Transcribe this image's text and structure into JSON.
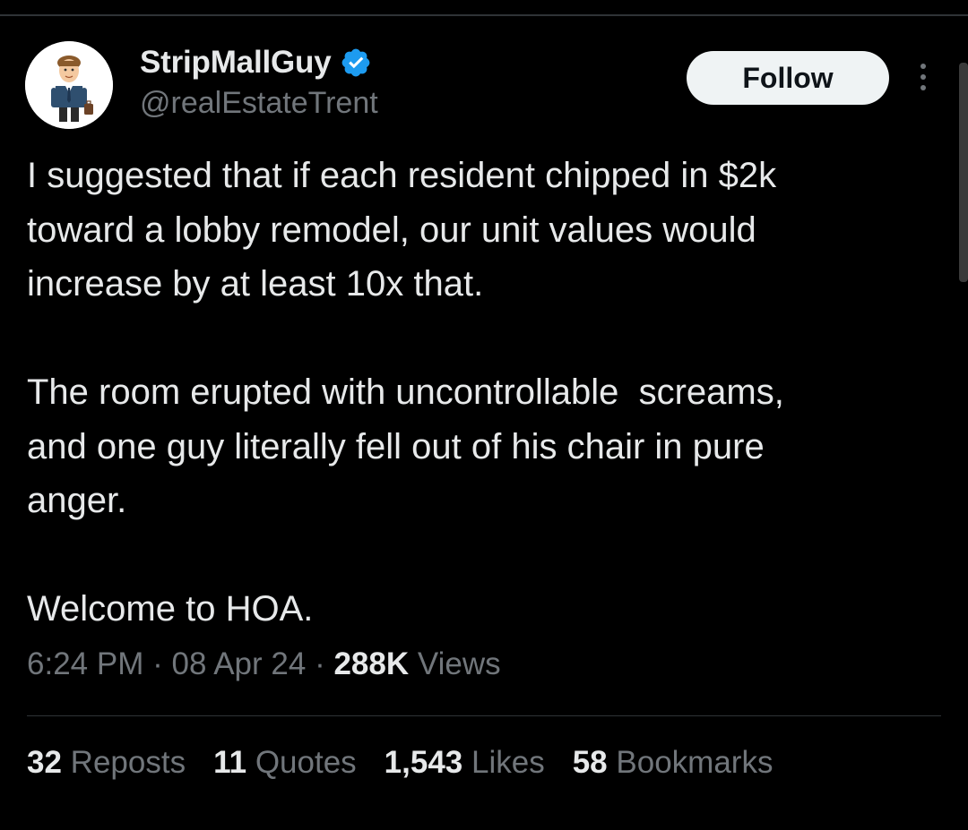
{
  "author": {
    "display_name": "StripMallGuy",
    "handle": "@realEstateTrent",
    "verified": true,
    "avatar_icon": "businessman-avatar-icon"
  },
  "header": {
    "follow_label": "Follow",
    "more_icon": "more-vertical-icon"
  },
  "tweet": {
    "text": "I suggested that if each resident chipped in $2k\ntoward a lobby remodel, our unit values would\nincrease by at least 10x that.\n\nThe room erupted with uncontrollable  screams,\nand one guy literally fell out of his chair in pure\nanger.\n\nWelcome to HOA."
  },
  "meta": {
    "time": "6:24 PM",
    "separator": "·",
    "date": "08 Apr 24",
    "views_count": "288K",
    "views_label": "Views"
  },
  "stats": [
    {
      "count": "32",
      "label": "Reposts"
    },
    {
      "count": "11",
      "label": "Quotes"
    },
    {
      "count": "1,543",
      "label": "Likes"
    },
    {
      "count": "58",
      "label": "Bookmarks"
    }
  ],
  "colors": {
    "background": "#000000",
    "primary_text": "#e7e9ea",
    "secondary_text": "#71767b",
    "verified_blue": "#1d9bf0",
    "follow_bg": "#eff3f4",
    "divider": "#2f3336"
  }
}
